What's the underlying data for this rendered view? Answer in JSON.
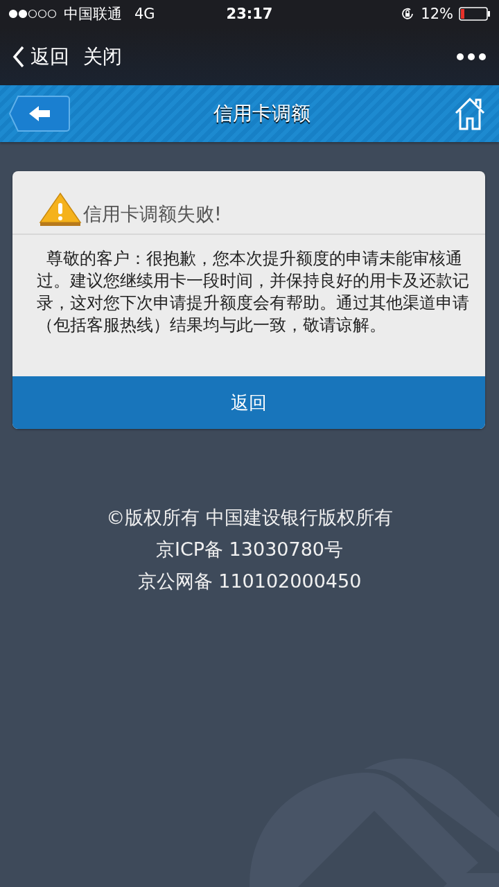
{
  "status_bar": {
    "carrier": "中国联通",
    "network": "4G",
    "time": "23:17",
    "battery": "12%"
  },
  "nav_bar": {
    "back_label": "返回",
    "close_label": "关闭"
  },
  "header": {
    "title": "信用卡调额"
  },
  "card": {
    "title": "信用卡调额失败!",
    "message": "尊敬的客户：很抱歉，您本次提升额度的申请未能审核通过。建议您继续用卡一段时间，并保持良好的用卡及还款记录，这对您下次申请提升额度会有帮助。通过其他渠道申请（包括客服热线）结果均与此一致，敬请谅解。",
    "button": "返回"
  },
  "footer": [
    "©版权所有 中国建设银行版权所有",
    "京ICP备 13030780号",
    "京公网备 110102000450"
  ]
}
